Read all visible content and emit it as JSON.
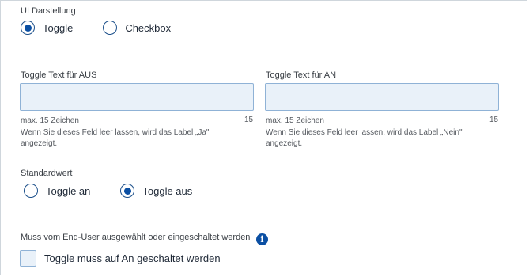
{
  "ui_display": {
    "label": "UI Darstellung",
    "options": [
      "Toggle",
      "Checkbox"
    ],
    "selected_index": 0
  },
  "toggle_off": {
    "label": "Toggle Text für AUS",
    "value": "",
    "max_text": "max. 15 Zeichen",
    "remaining": "15",
    "hint": "Wenn Sie dieses Feld leer lassen, wird das Label „Ja\" angezeigt."
  },
  "toggle_on": {
    "label": "Toggle Text für AN",
    "value": "",
    "max_text": "max. 15 Zeichen",
    "remaining": "15",
    "hint": "Wenn Sie dieses Feld leer lassen, wird das Label „Nein\" angezeigt."
  },
  "default_value": {
    "label": "Standardwert",
    "options": [
      "Toggle an",
      "Toggle aus"
    ],
    "selected_index": 1
  },
  "required": {
    "label": "Muss vom End-User ausgewählt oder eingeschaltet werden",
    "info_icon_glyph": "i",
    "checkbox_label": "Toggle muss auf An geschaltet werden",
    "checked": false
  }
}
